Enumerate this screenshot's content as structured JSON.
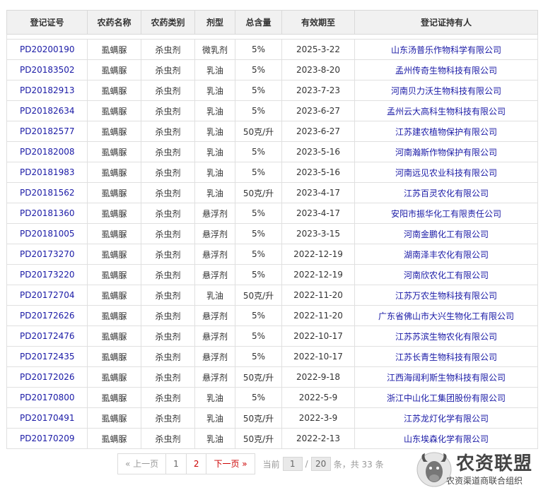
{
  "table": {
    "headers": [
      "登记证号",
      "农药名称",
      "农药类别",
      "剂型",
      "总含量",
      "有效期至",
      "登记证持有人"
    ],
    "rows": [
      {
        "code": "PD20200190",
        "name": "虱螨脲",
        "category": "杀虫剂",
        "form": "微乳剂",
        "content": "5%",
        "expiry": "2025-3-22",
        "holder": "山东汤普乐作物科学有限公司"
      },
      {
        "code": "PD20183502",
        "name": "虱螨脲",
        "category": "杀虫剂",
        "form": "乳油",
        "content": "5%",
        "expiry": "2023-8-20",
        "holder": "孟州传奇生物科技有限公司"
      },
      {
        "code": "PD20182913",
        "name": "虱螨脲",
        "category": "杀虫剂",
        "form": "乳油",
        "content": "5%",
        "expiry": "2023-7-23",
        "holder": "河南贝力沃生物科技有限公司"
      },
      {
        "code": "PD20182634",
        "name": "虱螨脲",
        "category": "杀虫剂",
        "form": "乳油",
        "content": "5%",
        "expiry": "2023-6-27",
        "holder": "孟州云大高科生物科技有限公司"
      },
      {
        "code": "PD20182577",
        "name": "虱螨脲",
        "category": "杀虫剂",
        "form": "乳油",
        "content": "50克/升",
        "expiry": "2023-6-27",
        "holder": "江苏建农植物保护有限公司"
      },
      {
        "code": "PD20182008",
        "name": "虱螨脲",
        "category": "杀虫剂",
        "form": "乳油",
        "content": "5%",
        "expiry": "2023-5-16",
        "holder": "河南瀚斯作物保护有限公司"
      },
      {
        "code": "PD20181983",
        "name": "虱螨脲",
        "category": "杀虫剂",
        "form": "乳油",
        "content": "5%",
        "expiry": "2023-5-16",
        "holder": "河南远见农业科技有限公司"
      },
      {
        "code": "PD20181562",
        "name": "虱螨脲",
        "category": "杀虫剂",
        "form": "乳油",
        "content": "50克/升",
        "expiry": "2023-4-17",
        "holder": "江苏百灵农化有限公司"
      },
      {
        "code": "PD20181360",
        "name": "虱螨脲",
        "category": "杀虫剂",
        "form": "悬浮剂",
        "content": "5%",
        "expiry": "2023-4-17",
        "holder": "安阳市振华化工有限责任公司"
      },
      {
        "code": "PD20181005",
        "name": "虱螨脲",
        "category": "杀虫剂",
        "form": "悬浮剂",
        "content": "5%",
        "expiry": "2023-3-15",
        "holder": "河南金鹏化工有限公司"
      },
      {
        "code": "PD20173270",
        "name": "虱螨脲",
        "category": "杀虫剂",
        "form": "悬浮剂",
        "content": "5%",
        "expiry": "2022-12-19",
        "holder": "湖南泽丰农化有限公司"
      },
      {
        "code": "PD20173220",
        "name": "虱螨脲",
        "category": "杀虫剂",
        "form": "悬浮剂",
        "content": "5%",
        "expiry": "2022-12-19",
        "holder": "河南欣农化工有限公司"
      },
      {
        "code": "PD20172704",
        "name": "虱螨脲",
        "category": "杀虫剂",
        "form": "乳油",
        "content": "50克/升",
        "expiry": "2022-11-20",
        "holder": "江苏万农生物科技有限公司"
      },
      {
        "code": "PD20172626",
        "name": "虱螨脲",
        "category": "杀虫剂",
        "form": "悬浮剂",
        "content": "5%",
        "expiry": "2022-11-20",
        "holder": "广东省佛山市大兴生物化工有限公司"
      },
      {
        "code": "PD20172476",
        "name": "虱螨脲",
        "category": "杀虫剂",
        "form": "悬浮剂",
        "content": "5%",
        "expiry": "2022-10-17",
        "holder": "江苏苏滨生物农化有限公司"
      },
      {
        "code": "PD20172435",
        "name": "虱螨脲",
        "category": "杀虫剂",
        "form": "悬浮剂",
        "content": "5%",
        "expiry": "2022-10-17",
        "holder": "江苏长青生物科技有限公司"
      },
      {
        "code": "PD20172026",
        "name": "虱螨脲",
        "category": "杀虫剂",
        "form": "悬浮剂",
        "content": "50克/升",
        "expiry": "2022-9-18",
        "holder": "江西海阔利斯生物科技有限公司"
      },
      {
        "code": "PD20170800",
        "name": "虱螨脲",
        "category": "杀虫剂",
        "form": "乳油",
        "content": "5%",
        "expiry": "2022-5-9",
        "holder": "浙江中山化工集团股份有限公司"
      },
      {
        "code": "PD20170491",
        "name": "虱螨脲",
        "category": "杀虫剂",
        "form": "乳油",
        "content": "50克/升",
        "expiry": "2022-3-9",
        "holder": "江苏龙灯化学有限公司"
      },
      {
        "code": "PD20170209",
        "name": "虱螨脲",
        "category": "杀虫剂",
        "form": "乳油",
        "content": "50克/升",
        "expiry": "2022-2-13",
        "holder": "山东埃森化学有限公司"
      }
    ]
  },
  "pager": {
    "prev_label": "« 上一页",
    "pages": [
      "1",
      "2"
    ],
    "next_label": "下一页 »",
    "current_prefix": "当前",
    "current_page": "1",
    "separator": "/",
    "total_pages": "20",
    "summary": "条，共 33 条"
  },
  "logo": {
    "main_text": "农资联盟",
    "sub_text": "农资渠道商联合组织"
  },
  "colors": {
    "link": "#1a1aa6",
    "header_bg": "#f1f1f1",
    "active_page": "#cc0000"
  }
}
